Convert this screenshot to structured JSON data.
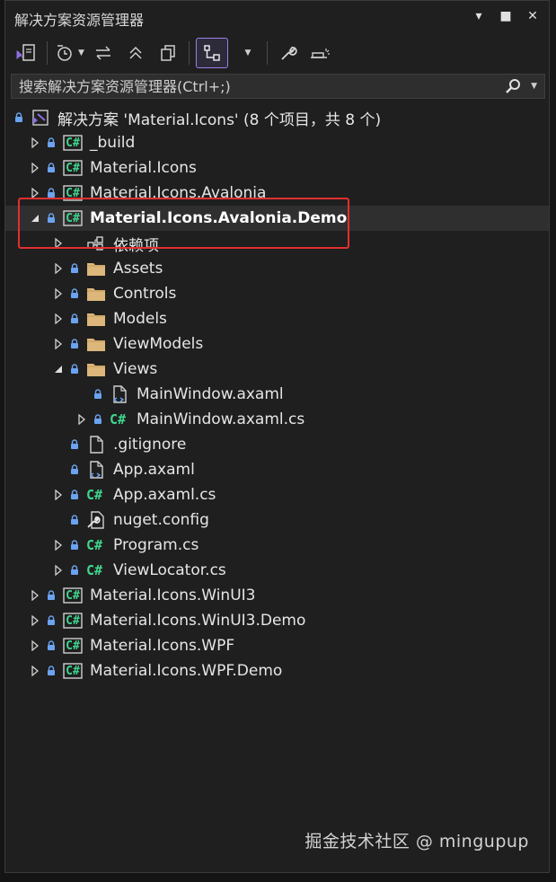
{
  "window": {
    "title": "解决方案资源管理器",
    "buttons": [
      "▾",
      "■",
      "✕"
    ]
  },
  "search": {
    "placeholder": "搜索解决方案资源管理器(Ctrl+;)"
  },
  "tree": {
    "solution": {
      "label": "解决方案 'Material.Icons' (8 个项目，共 8 个)"
    },
    "items": [
      {
        "label": "_build",
        "type": "csproj",
        "level": 1,
        "expander": "collapsed"
      },
      {
        "label": "Material.Icons",
        "type": "csproj",
        "level": 1,
        "expander": "collapsed"
      },
      {
        "label": "Material.Icons.Avalonia",
        "type": "csproj",
        "level": 1,
        "expander": "collapsed"
      },
      {
        "label": "Material.Icons.Avalonia.Demo",
        "type": "csproj",
        "level": 1,
        "expander": "expanded",
        "bold": true,
        "selected": true
      },
      {
        "label": "依赖项",
        "type": "deps",
        "level": 2,
        "expander": "collapsed",
        "nolock": true
      },
      {
        "label": "Assets",
        "type": "folder",
        "level": 2,
        "expander": "collapsed"
      },
      {
        "label": "Controls",
        "type": "folder",
        "level": 2,
        "expander": "collapsed"
      },
      {
        "label": "Models",
        "type": "folder",
        "level": 2,
        "expander": "collapsed"
      },
      {
        "label": "ViewModels",
        "type": "folder",
        "level": 2,
        "expander": "collapsed"
      },
      {
        "label": "Views",
        "type": "folder",
        "level": 2,
        "expander": "expanded"
      },
      {
        "label": "MainWindow.axaml",
        "type": "xaml",
        "level": 3,
        "expander": "none"
      },
      {
        "label": "MainWindow.axaml.cs",
        "type": "cs",
        "level": 3,
        "expander": "collapsed"
      },
      {
        "label": ".gitignore",
        "type": "file",
        "level": 2,
        "expander": "none"
      },
      {
        "label": "App.axaml",
        "type": "xaml",
        "level": 2,
        "expander": "none"
      },
      {
        "label": "App.axaml.cs",
        "type": "cs",
        "level": 2,
        "expander": "collapsed"
      },
      {
        "label": "nuget.config",
        "type": "config",
        "level": 2,
        "expander": "none"
      },
      {
        "label": "Program.cs",
        "type": "cs",
        "level": 2,
        "expander": "collapsed"
      },
      {
        "label": "ViewLocator.cs",
        "type": "cs",
        "level": 2,
        "expander": "collapsed"
      },
      {
        "label": "Material.Icons.WinUI3",
        "type": "csproj",
        "level": 1,
        "expander": "collapsed"
      },
      {
        "label": "Material.Icons.WinUI3.Demo",
        "type": "csproj",
        "level": 1,
        "expander": "collapsed"
      },
      {
        "label": "Material.Icons.WPF",
        "type": "csproj",
        "level": 1,
        "expander": "collapsed"
      },
      {
        "label": "Material.Icons.WPF.Demo",
        "type": "csproj",
        "level": 1,
        "expander": "collapsed"
      }
    ]
  },
  "icon_labels": {
    "csharp": "C#"
  },
  "watermark": "掘金技术社区 @ mingupup",
  "colors": {
    "background": "#1f1f1f",
    "selected_row": "#2f2f2f",
    "csharp_green": "#3fd68d",
    "lock_blue": "#6aa3f0",
    "folder_yellow": "#dcb67a",
    "highlight_red": "#e0302f",
    "active_tool_purple": "#9a7fe6"
  }
}
